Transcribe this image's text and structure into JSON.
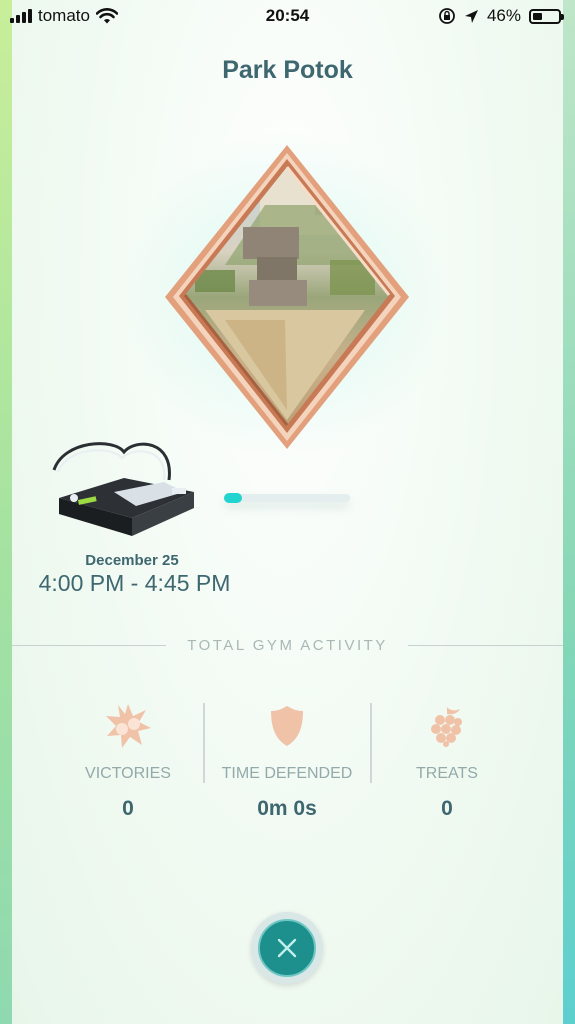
{
  "status_bar": {
    "carrier": "tomato",
    "time": "20:54",
    "battery_text": "46%",
    "battery_level": 0.46
  },
  "gym": {
    "name": "Park Potok",
    "badge_progress": 0.14
  },
  "badge": {
    "date": "December 25",
    "time_range": "4:00 PM - 4:45 PM"
  },
  "activity": {
    "header": "TOTAL GYM ACTIVITY",
    "stats": [
      {
        "label": "VICTORIES",
        "value": "0",
        "icon": "victories-burst-icon"
      },
      {
        "label": "TIME DEFENDED",
        "value": "0m 0s",
        "icon": "shield-icon"
      },
      {
        "label": "TREATS",
        "value": "0",
        "icon": "berry-icon"
      }
    ]
  },
  "colors": {
    "title_text": "#3e6770",
    "accent_teal": "#22d3cf",
    "bronze": "#d98c6a",
    "icon_peach": "#f0c3a8",
    "close_button": "#1d8f8d"
  }
}
